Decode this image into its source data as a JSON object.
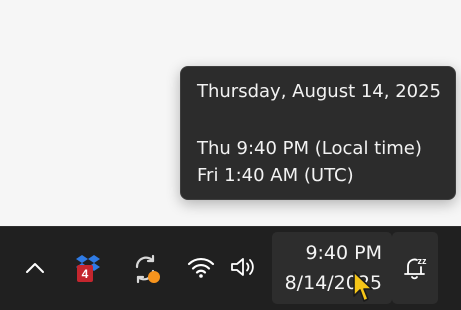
{
  "tooltip": {
    "full_date": "Thursday, August 14, 2025",
    "local_time": "Thu 9:40 PM (Local time)",
    "utc_time": "Fri 1:40 AM (UTC)"
  },
  "taskbar": {
    "clock": {
      "time": "9:40 PM",
      "date": "8/14/2025"
    },
    "tray_icons": [
      {
        "icon": "chevron-up-icon"
      },
      {
        "icon": "dropbox-icon",
        "badge": "4",
        "badge_color": "#c4262e"
      },
      {
        "icon": "sync-icon",
        "status_color": "#f7941d"
      },
      {
        "icon": "wifi-icon"
      },
      {
        "icon": "volume-icon"
      },
      {
        "icon": "notifications-snoozed-icon",
        "badge": "zz"
      }
    ]
  },
  "colors": {
    "taskbar": "#202020",
    "tooltip_bg": "#2c2c2c",
    "text": "#f2f2f2"
  }
}
